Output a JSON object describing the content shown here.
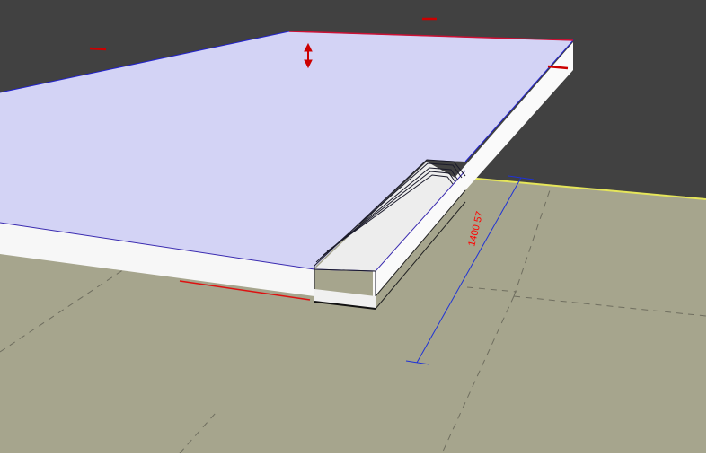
{
  "viewport": {
    "name": "3d-model-viewport",
    "background_color": "#414141",
    "ground_color": "#a6a58d",
    "horizon_color": "#e5e55a"
  },
  "model": {
    "panel_top_color": "#d0d0f4",
    "panel_edge_color": "#f5f5f5",
    "selection_edge_color": "#2222cc",
    "highlight_edge_color": "#cc0000",
    "cutout": "handle-groove"
  },
  "dimension": {
    "value": "1400.57",
    "color": "#ff0000",
    "line_color": "#1f33d6"
  },
  "icons": {
    "move_arrow": "vertical-move-arrow-icon",
    "grip": "grip-handle-icon"
  }
}
